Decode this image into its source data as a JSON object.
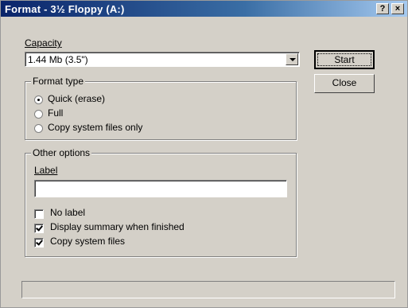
{
  "window": {
    "title": "Format - 3½ Floppy (A:)",
    "help_button": "?",
    "close_button": "×"
  },
  "capacity": {
    "label": "Capacity",
    "selected": "1.44 Mb (3.5\")"
  },
  "format_type": {
    "title": "Format type",
    "options": [
      {
        "label": "Quick (erase)",
        "selected": true
      },
      {
        "label": "Full",
        "selected": false
      },
      {
        "label": "Copy system files only",
        "selected": false
      }
    ]
  },
  "other_options": {
    "title": "Other options",
    "label_field": {
      "label": "Label",
      "value": ""
    },
    "checkboxes": [
      {
        "label": "No label",
        "checked": false
      },
      {
        "label": "Display summary when finished",
        "checked": true
      },
      {
        "label": "Copy system files",
        "checked": true
      }
    ]
  },
  "buttons": {
    "start": "Start",
    "close": "Close"
  }
}
